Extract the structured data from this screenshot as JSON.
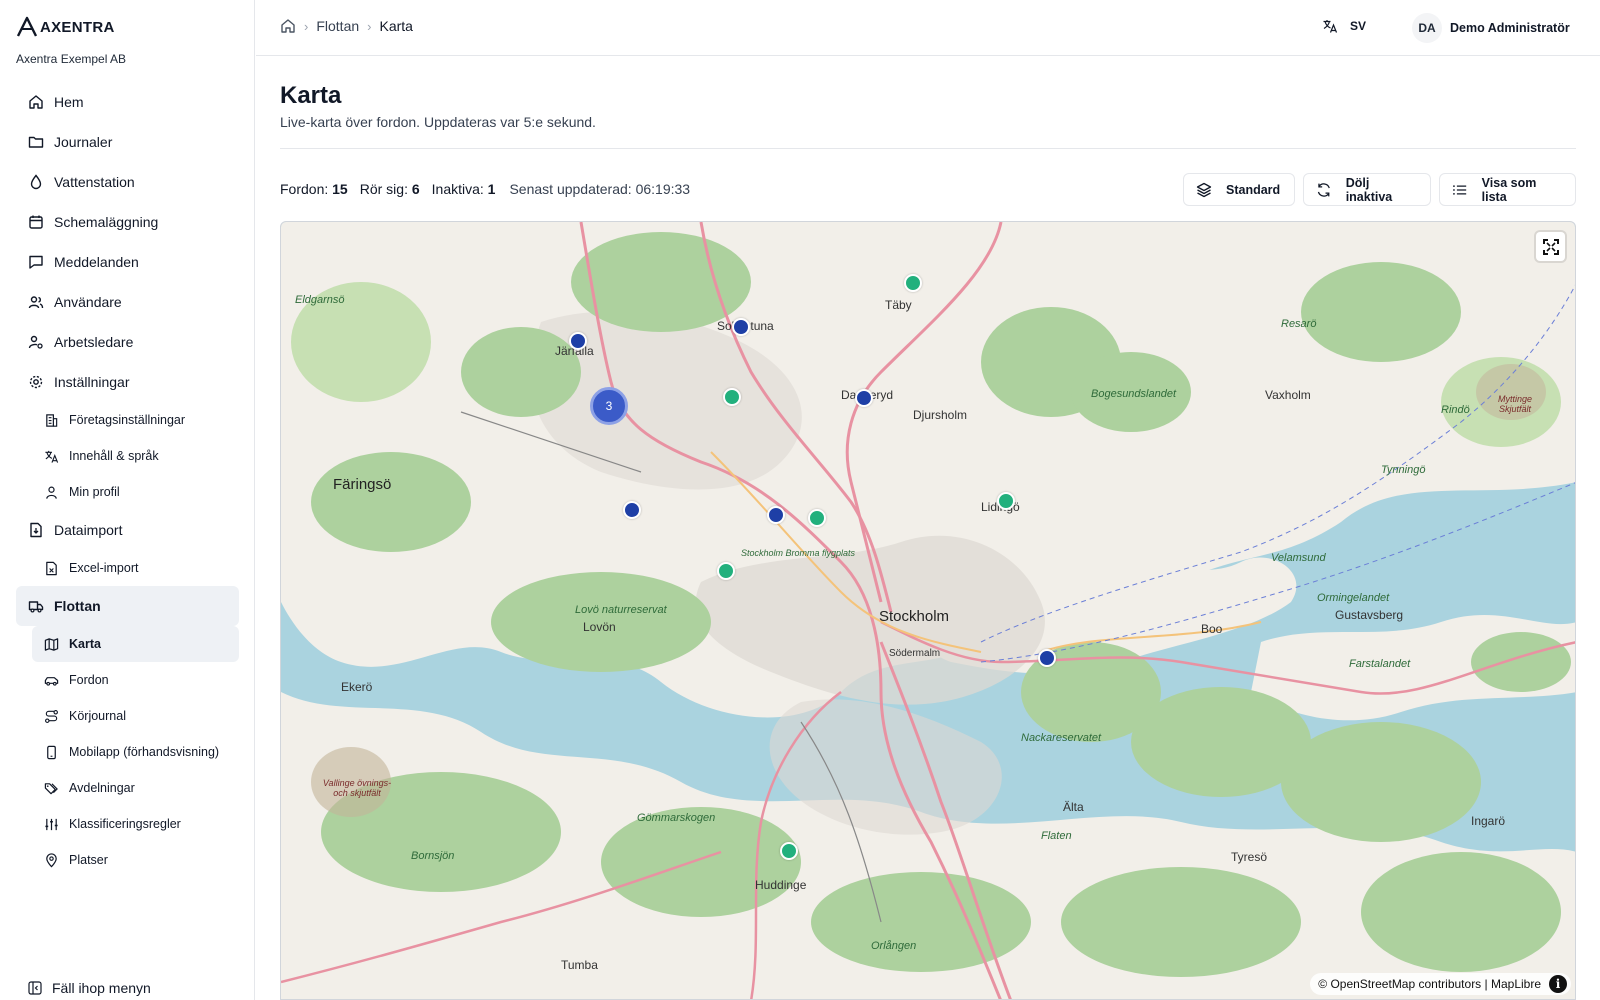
{
  "brand": {
    "name": "AXENTRA",
    "org": "Axentra Exempel AB"
  },
  "nav": {
    "home": "Hem",
    "journals": "Journaler",
    "water_station": "Vattenstation",
    "scheduling": "Schemaläggning",
    "messages": "Meddelanden",
    "users": "Användare",
    "supervisors": "Arbetsledare",
    "settings": "Inställningar",
    "company_settings": "Företagsinställningar",
    "content_language": "Innehåll & språk",
    "my_profile": "Min profil",
    "data_import": "Dataimport",
    "excel_import": "Excel-import",
    "fleet": "Flottan",
    "map": "Karta",
    "vehicles": "Fordon",
    "driving_log": "Körjournal",
    "mobile_app": "Mobilapp (förhandsvisning)",
    "departments": "Avdelningar",
    "classification_rules": "Klassificeringsregler",
    "places": "Platser",
    "collapse": "Fäll ihop menyn"
  },
  "breadcrumb": {
    "parent": "Flottan",
    "current": "Karta"
  },
  "header": {
    "language": "SV",
    "user_initials": "DA",
    "user_name": "Demo Administratör"
  },
  "page": {
    "title": "Karta",
    "subtitle": "Live-karta över fordon. Uppdateras var 5:e sekund."
  },
  "stats": {
    "vehicles_label": "Fordon:",
    "vehicles_value": "15",
    "moving_label": "Rör sig:",
    "moving_value": "6",
    "inactive_label": "Inaktiva:",
    "inactive_value": "1",
    "updated": "Senast uppdaterad: 06:19:33"
  },
  "toolbar": {
    "standard": "Standard",
    "hide_inactive": "Dölj inaktiva",
    "show_list": "Visa som lista"
  },
  "map": {
    "attribution": "© OpenStreetMap contributors | MapLibre",
    "cluster_count": "3",
    "labels": {
      "stockholm": "Stockholm",
      "faringso": "Färingsö",
      "vaxholm": "Vaxholm",
      "djursholm": "Djursholm",
      "taby": "Täby",
      "jarfalla": "Järfälla",
      "solna_sollentuna": "Sollentuna",
      "lidingo": "Lidingö",
      "danderyd": "Danderyd",
      "huddinge": "Huddinge",
      "tumba": "Tumba",
      "boo": "Boo",
      "gustavsberg": "Gustavsberg",
      "ekero": "Ekerö",
      "lovon": "Lovön",
      "alta": "Älta",
      "tyreso": "Tyresö",
      "ingaro": "Ingarö",
      "sodermalm": "Södermalm",
      "bogesundslandet": "Bogesundslandet",
      "ormingelandet": "Ormingelandet",
      "farstalandet": "Farstalandet",
      "lovo_nr": "Lovö naturreservat",
      "nacka_nr": "Nackareservatet",
      "bromma": "Stockholm Bromma flygplats",
      "resaro": "Resarö",
      "rindo": "Rindö",
      "tynningo": "Tynningö",
      "flaten": "Flaten",
      "bornsjon": "Bornsjön",
      "gommarskogen": "Gömmarskogen",
      "orlangen": "Orlången",
      "vallinge": "Vallinge övnings- och skjutfält",
      "myttinge": "Myttinge Skjutfält",
      "velamsund": "Velamsund",
      "eldgarnso": "Eldgarnsö"
    }
  },
  "colors": {
    "moving": "#22b07d",
    "idle": "#1e3fa6",
    "cluster": "#3b5bc8",
    "water": "#aad3df",
    "land": "#f2efe9",
    "forest": "#add19e",
    "motorway": "#e892a2"
  }
}
